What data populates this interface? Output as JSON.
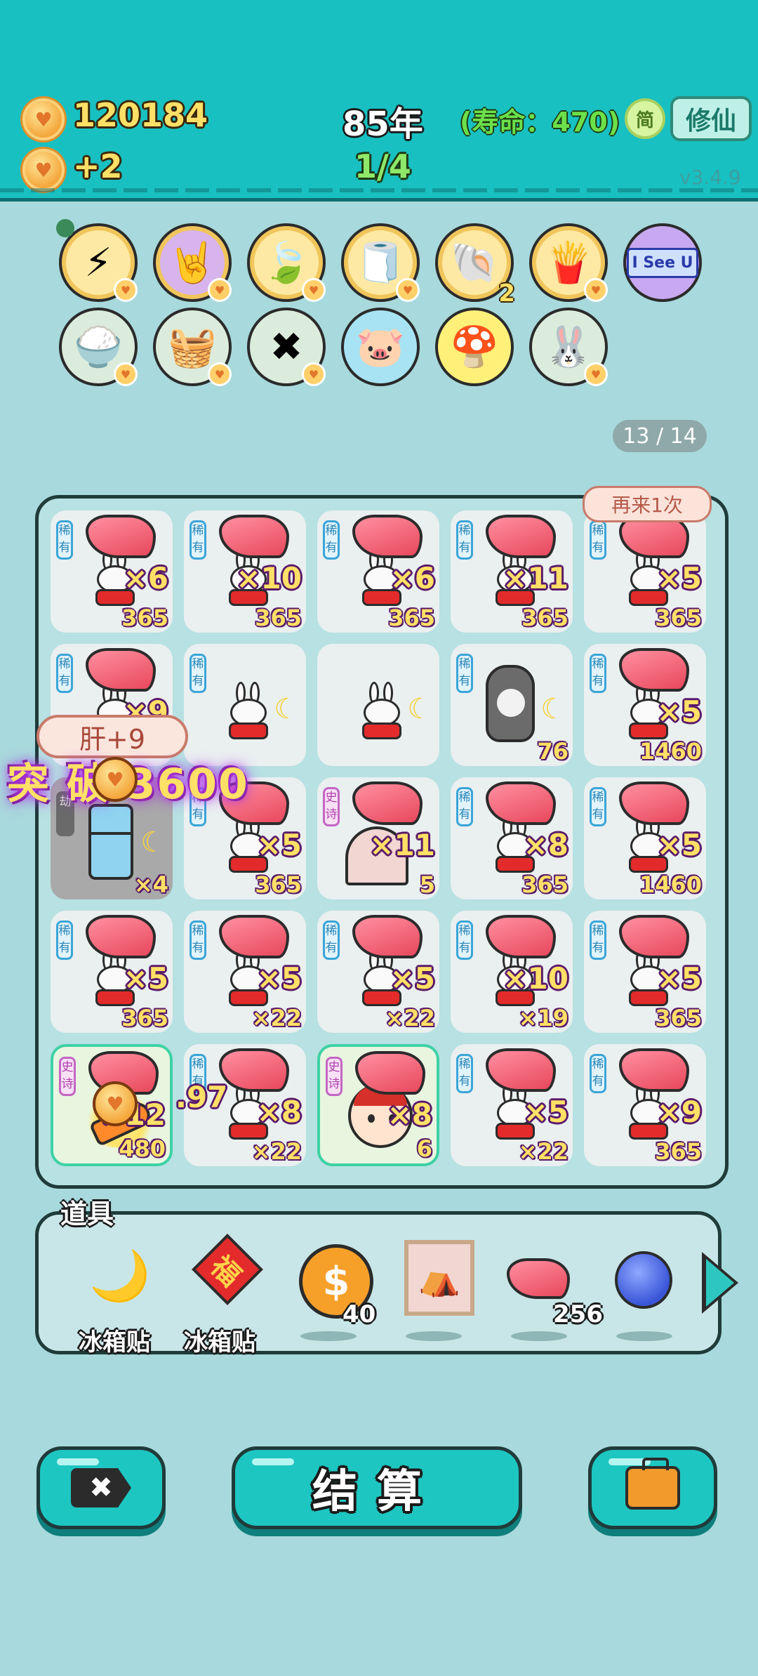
{
  "header": {
    "coins": "120184",
    "income": "+2",
    "year": "85年",
    "round": "1/4",
    "lifespan": "(寿命：470)",
    "simplified_label": "简",
    "cultivate_button": "修仙",
    "version": "v3.4.9"
  },
  "buffs": {
    "row1": [
      {
        "icon": "lightning-icon",
        "glyph": "⚡",
        "style": "gold"
      },
      {
        "icon": "rock-hand-icon",
        "glyph": "🤘",
        "style": "pink"
      },
      {
        "icon": "leaf-icon",
        "glyph": "🍃",
        "style": "gold"
      },
      {
        "icon": "tissue-box-icon",
        "glyph": "🧻",
        "style": "gold"
      },
      {
        "icon": "shell-icon",
        "glyph": "🐚",
        "style": "gold",
        "count": "2"
      },
      {
        "icon": "fries-icon",
        "glyph": "🍟",
        "style": "gold"
      },
      {
        "icon": "i-see-u-icon",
        "glyph": "I See U",
        "style": "lav"
      }
    ],
    "row2": [
      {
        "icon": "rice-bowl-icon",
        "glyph": "🍚",
        "style": "plain"
      },
      {
        "icon": "fruit-basket-icon",
        "glyph": "🧺",
        "style": "plain"
      },
      {
        "icon": "delete-tag-icon",
        "glyph": "✖",
        "style": "plain"
      },
      {
        "icon": "piggy-bank-icon",
        "glyph": "🐷",
        "style": "blue"
      },
      {
        "icon": "mushroom-cloud-icon",
        "glyph": "🍄",
        "style": "yellow"
      },
      {
        "icon": "bunny-icon",
        "glyph": "🐰",
        "style": "plain"
      }
    ]
  },
  "page_indicator": "13 / 14",
  "reroll_button": "再来1次",
  "rarity": {
    "rare": "稀有",
    "epic": "史诗",
    "locked": "劫"
  },
  "grid": [
    {
      "type": "bunny-liver",
      "rarity": "rare",
      "mult": "×6",
      "value": "365"
    },
    {
      "type": "bunny-liver",
      "rarity": "rare",
      "mult": "×10",
      "value": "365"
    },
    {
      "type": "bunny-liver",
      "rarity": "rare",
      "mult": "×6",
      "value": "365"
    },
    {
      "type": "bunny-liver",
      "rarity": "rare",
      "mult": "×11",
      "value": "365"
    },
    {
      "type": "bunny-liver",
      "rarity": "rare",
      "mult": "×5",
      "value": "365"
    },
    {
      "type": "bunny-liver",
      "rarity": "rare",
      "mult": "×9",
      "value": ""
    },
    {
      "type": "bunny-moon",
      "rarity": "rare",
      "mult": "",
      "value": ""
    },
    {
      "type": "bunny-moon",
      "rarity": "",
      "mult": "",
      "value": ""
    },
    {
      "type": "husky",
      "rarity": "rare",
      "mult": "",
      "value": "76"
    },
    {
      "type": "bunny-liver",
      "rarity": "rare",
      "mult": "×5",
      "value": "1460"
    },
    {
      "type": "fridge",
      "rarity": "locked",
      "mult": "",
      "value": "×4"
    },
    {
      "type": "bunny-liver",
      "rarity": "rare",
      "mult": "×5",
      "value": "365"
    },
    {
      "type": "tent",
      "rarity": "epic",
      "mult": "×11",
      "value": "5"
    },
    {
      "type": "bunny-liver",
      "rarity": "rare",
      "mult": "×8",
      "value": "365"
    },
    {
      "type": "bunny-liver",
      "rarity": "rare",
      "mult": "×5",
      "value": "1460"
    },
    {
      "type": "bunny-liver",
      "rarity": "rare",
      "mult": "×5",
      "value": "365"
    },
    {
      "type": "bunny-liver",
      "rarity": "rare",
      "mult": "×5",
      "value": "×22"
    },
    {
      "type": "bunny-liver",
      "rarity": "rare",
      "mult": "×5",
      "value": "×22"
    },
    {
      "type": "bunny-liver",
      "rarity": "rare",
      "mult": "×10",
      "value": "×19"
    },
    {
      "type": "bunny-liver",
      "rarity": "rare",
      "mult": "×5",
      "value": "365"
    },
    {
      "type": "carrot",
      "rarity": "epic",
      "mult": "×12",
      "value": "480"
    },
    {
      "type": "bunny-liver",
      "rarity": "rare",
      "mult": "×8",
      "value": "×22"
    },
    {
      "type": "kid",
      "rarity": "epic",
      "mult": "×8",
      "value": "6"
    },
    {
      "type": "bunny-liver",
      "rarity": "rare",
      "mult": "×5",
      "value": "×22"
    },
    {
      "type": "bunny-liver",
      "rarity": "rare",
      "mult": "×9",
      "value": "365"
    }
  ],
  "floating": {
    "liver_popup": "肝+9",
    "breakthrough": "突 破 3600",
    "coin_value": ".97"
  },
  "tools": {
    "title": "道具",
    "items": [
      {
        "icon": "moon-sticker-icon",
        "glyph": "🌙",
        "label": "冰箱贴",
        "count": ""
      },
      {
        "icon": "fu-sticker-icon",
        "glyph": "福",
        "label": "冰箱贴",
        "count": ""
      },
      {
        "icon": "gold-coin-icon",
        "glyph": "$",
        "label": "",
        "count": "40"
      },
      {
        "icon": "bunny-tent-frame-icon",
        "glyph": "⛺",
        "label": "",
        "count": ""
      },
      {
        "icon": "liver-icon",
        "glyph": "",
        "label": "",
        "count": "256"
      },
      {
        "icon": "blueberry-icon",
        "glyph": "",
        "label": "",
        "count": ""
      }
    ]
  },
  "actions": {
    "discard_icon": "✖",
    "settle_label": "结算",
    "bag_icon": "briefcase-icon"
  },
  "colors": {
    "topbar": "#18c0c1",
    "background": "#a8d9dc",
    "button": "#1ec6c1",
    "coin": "#f4a73c",
    "text_gold": "#ffe066"
  }
}
